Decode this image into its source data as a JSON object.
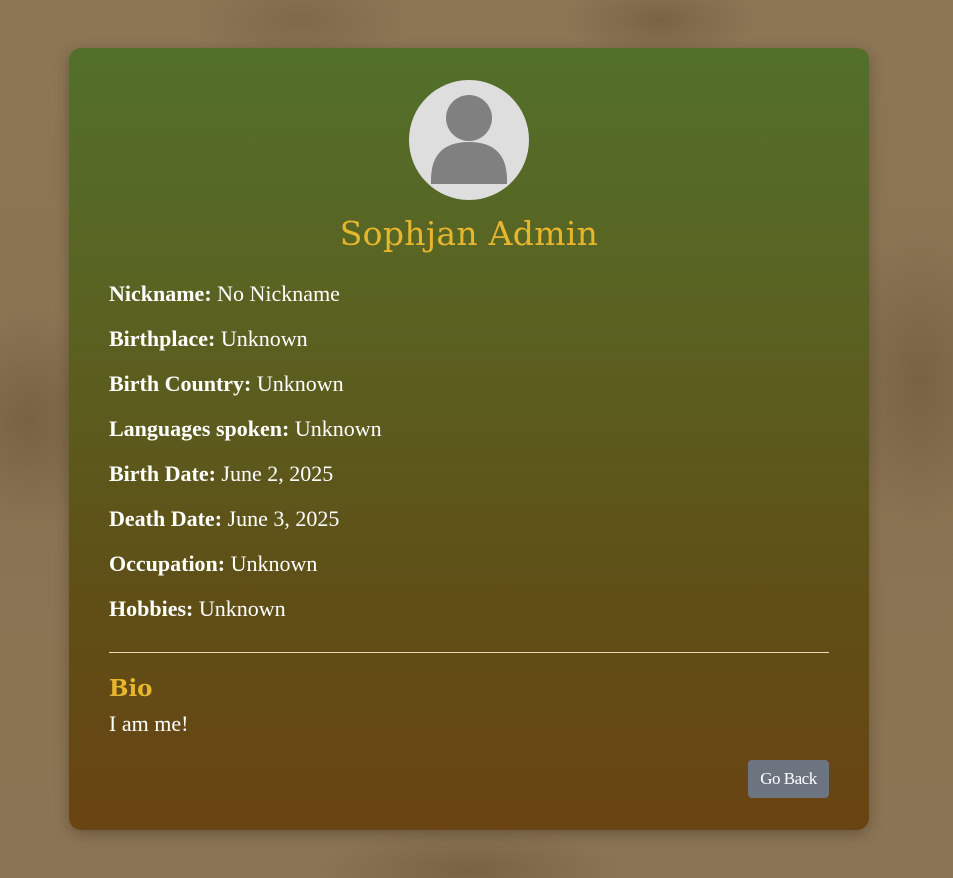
{
  "profile": {
    "name": "Sophjan Admin",
    "fields": [
      {
        "label": "Nickname:",
        "value": "No Nickname"
      },
      {
        "label": "Birthplace:",
        "value": "Unknown"
      },
      {
        "label": "Birth Country:",
        "value": "Unknown"
      },
      {
        "label": "Languages spoken:",
        "value": "Unknown"
      },
      {
        "label": "Birth Date:",
        "value": "June 2, 2025"
      },
      {
        "label": "Death Date:",
        "value": "June 3, 2025"
      },
      {
        "label": "Occupation:",
        "value": "Unknown"
      },
      {
        "label": "Hobbies:",
        "value": "Unknown"
      }
    ],
    "bio_title": "Bio",
    "bio_text": "I am me!",
    "back_button_label": "Go Back",
    "avatar_icon": "user-placeholder-icon"
  },
  "colors": {
    "accent": "#e8b62c",
    "card_top": "#52702a",
    "card_bottom": "#6a4412",
    "button": "#6c7480"
  }
}
